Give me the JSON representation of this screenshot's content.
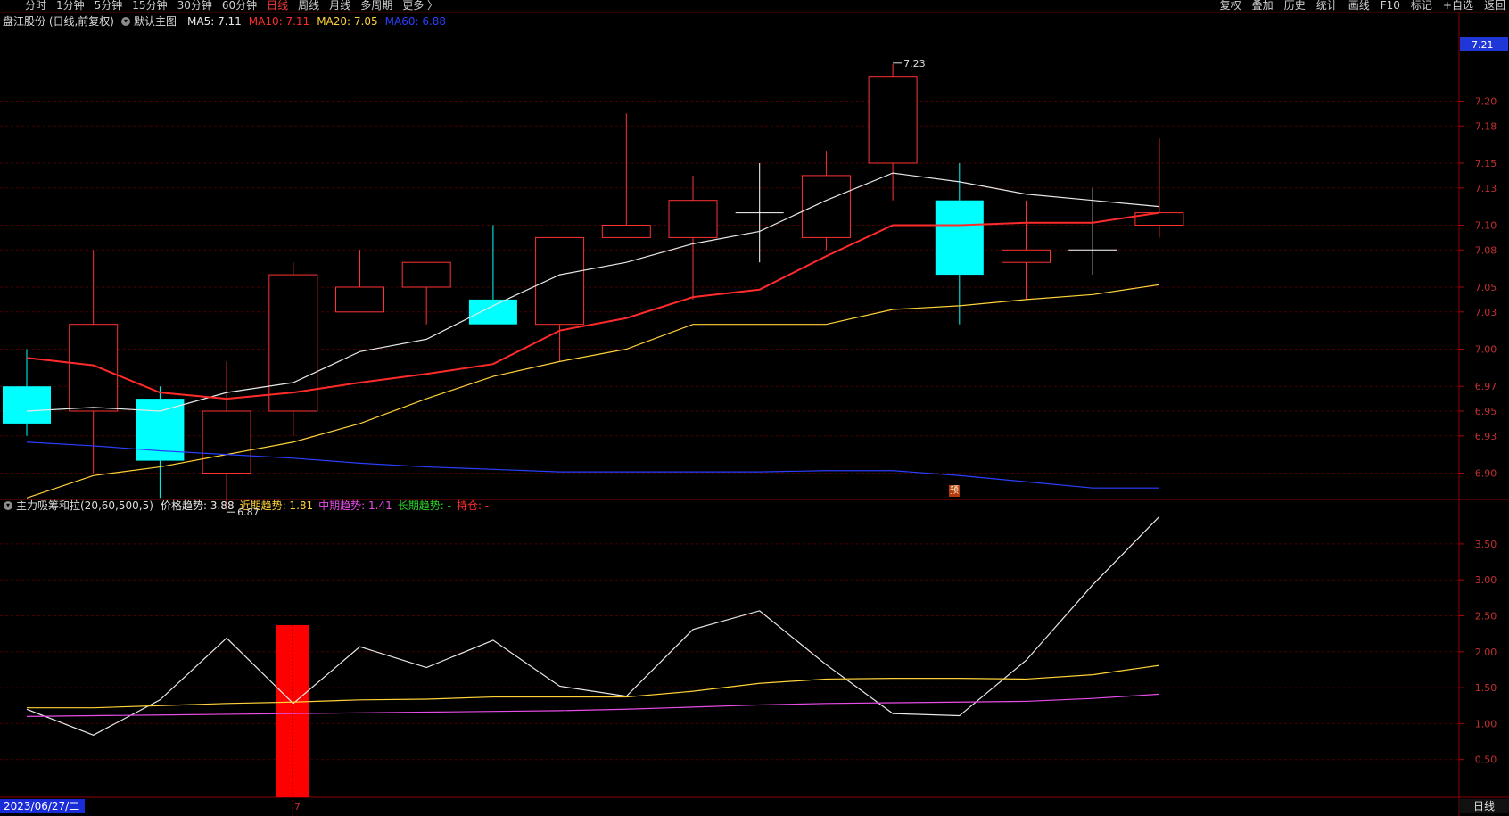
{
  "topbar": {
    "left_items": [
      "分时",
      "1分钟",
      "5分钟",
      "15分钟",
      "30分钟",
      "60分钟",
      "日线",
      "周线",
      "月线",
      "多周期",
      "更多 〉"
    ],
    "active": "日线",
    "right_items": [
      "复权",
      "叠加",
      "历史",
      "统计",
      "画线",
      "F10",
      "标记",
      "+自选",
      "返回"
    ]
  },
  "main_header": {
    "stock": "盘江股份 (日线,前复权)",
    "chart_name": "默认主图",
    "ma": [
      {
        "text": "MA5: 7.11",
        "color": "#e8e8e8"
      },
      {
        "text": "MA10: 7.11",
        "color": "#ff2b2b"
      },
      {
        "text": "MA20: 7.05",
        "color": "#ffd23a"
      },
      {
        "text": "MA60: 6.88",
        "color": "#2a3fff"
      }
    ]
  },
  "ind_header": {
    "name": "主力吸筹和拉(20,60,500,5)",
    "items": [
      {
        "text": "价格趋势: 3.88",
        "color": "#e8e8e8"
      },
      {
        "text": "近期趋势: 1.81",
        "color": "#ffd23a"
      },
      {
        "text": "中期趋势: 1.41",
        "color": "#e84ce8"
      },
      {
        "text": "长期趋势: -",
        "color": "#2bd62b"
      },
      {
        "text": "持仓: -",
        "color": "#ff2b2b"
      }
    ]
  },
  "chart_data": [
    {
      "type": "candlestick",
      "ylim": [
        6.84,
        7.25
      ],
      "y_ticks": [
        "7.20",
        "7.18",
        "7.15",
        "7.13",
        "7.10",
        "7.08",
        "7.05",
        "7.03",
        "7.00",
        "6.97",
        "6.95",
        "6.93",
        "6.90"
      ],
      "last_price": "7.21",
      "high_label": "7.23",
      "low_label": "6.87",
      "candles": [
        {
          "o": 6.97,
          "c": 6.94,
          "h": 7.0,
          "l": 6.93
        },
        {
          "o": 6.95,
          "c": 7.02,
          "h": 7.08,
          "l": 6.9
        },
        {
          "o": 6.96,
          "c": 6.91,
          "h": 6.97,
          "l": 6.88
        },
        {
          "o": 6.9,
          "c": 6.95,
          "h": 6.99,
          "l": 6.87
        },
        {
          "o": 6.95,
          "c": 7.06,
          "h": 7.07,
          "l": 6.93
        },
        {
          "o": 7.03,
          "c": 7.05,
          "h": 7.08,
          "l": 7.03
        },
        {
          "o": 7.05,
          "c": 7.07,
          "h": 7.07,
          "l": 7.02
        },
        {
          "o": 7.04,
          "c": 7.02,
          "h": 7.1,
          "l": 7.02
        },
        {
          "o": 7.02,
          "c": 7.09,
          "h": 7.09,
          "l": 6.99
        },
        {
          "o": 7.09,
          "c": 7.1,
          "h": 7.19,
          "l": 7.09
        },
        {
          "o": 7.09,
          "c": 7.12,
          "h": 7.14,
          "l": 7.04
        },
        {
          "o": 7.11,
          "c": 7.11,
          "h": 7.15,
          "l": 7.07
        },
        {
          "o": 7.09,
          "c": 7.14,
          "h": 7.16,
          "l": 7.08
        },
        {
          "o": 7.15,
          "c": 7.22,
          "h": 7.23,
          "l": 7.12
        },
        {
          "o": 7.12,
          "c": 7.06,
          "h": 7.15,
          "l": 7.02
        },
        {
          "o": 7.07,
          "c": 7.08,
          "h": 7.12,
          "l": 7.04
        },
        {
          "o": 7.08,
          "c": 7.08,
          "h": 7.13,
          "l": 7.06
        },
        {
          "o": 7.1,
          "c": 7.11,
          "h": 7.17,
          "l": 7.09
        }
      ],
      "series": [
        {
          "name": "MA5",
          "color": "#e8e8e8",
          "values": [
            6.95,
            6.953,
            6.95,
            6.965,
            6.973,
            6.998,
            7.008,
            7.035,
            7.06,
            7.07,
            7.085,
            7.095,
            7.12,
            7.142,
            7.135,
            7.125,
            7.12,
            7.115
          ]
        },
        {
          "name": "MA10",
          "color": "#ff2b2b",
          "values": [
            6.993,
            6.987,
            6.965,
            6.96,
            6.965,
            6.973,
            6.98,
            6.988,
            7.015,
            7.025,
            7.042,
            7.048,
            7.075,
            7.1,
            7.1,
            7.102,
            7.102,
            7.11
          ]
        },
        {
          "name": "MA20",
          "color": "#ffd23a",
          "values": [
            6.88,
            6.898,
            6.905,
            6.915,
            6.925,
            6.94,
            6.96,
            6.978,
            6.99,
            7.0,
            7.02,
            7.02,
            7.02,
            7.032,
            7.035,
            7.04,
            7.044,
            7.052
          ]
        },
        {
          "name": "MA60",
          "color": "#2a3fff",
          "values": [
            6.925,
            6.922,
            6.918,
            6.915,
            6.912,
            6.908,
            6.905,
            6.903,
            6.901,
            6.901,
            6.901,
            6.901,
            6.902,
            6.902,
            6.898,
            6.893,
            6.888,
            6.888
          ]
        }
      ]
    },
    {
      "type": "line",
      "ylim": [
        0,
        3.95
      ],
      "y_ticks": [
        "3.50",
        "3.00",
        "2.50",
        "2.00",
        "1.50",
        "1.00",
        "0.50"
      ],
      "signal_bar": {
        "index": 4,
        "value": 2.37
      },
      "series": [
        {
          "name": "价格趋势",
          "color": "#e8e8e8",
          "values": [
            1.2,
            0.84,
            1.33,
            2.19,
            1.28,
            2.07,
            1.78,
            2.16,
            1.52,
            1.38,
            2.31,
            2.57,
            1.82,
            1.14,
            1.11,
            1.88,
            2.93,
            3.88
          ]
        },
        {
          "name": "近期趋势",
          "color": "#ffd23a",
          "values": [
            1.22,
            1.22,
            1.25,
            1.28,
            1.3,
            1.33,
            1.34,
            1.37,
            1.37,
            1.37,
            1.45,
            1.56,
            1.62,
            1.63,
            1.63,
            1.62,
            1.68,
            1.81
          ]
        },
        {
          "name": "中期趋势",
          "color": "#e84ce8",
          "values": [
            1.1,
            1.11,
            1.12,
            1.13,
            1.14,
            1.15,
            1.16,
            1.17,
            1.18,
            1.2,
            1.23,
            1.26,
            1.28,
            1.29,
            1.3,
            1.31,
            1.35,
            1.41
          ]
        }
      ]
    }
  ],
  "footer": {
    "date": "2023/06/27/二",
    "marker": "7",
    "period": "日线",
    "badge": "预"
  }
}
